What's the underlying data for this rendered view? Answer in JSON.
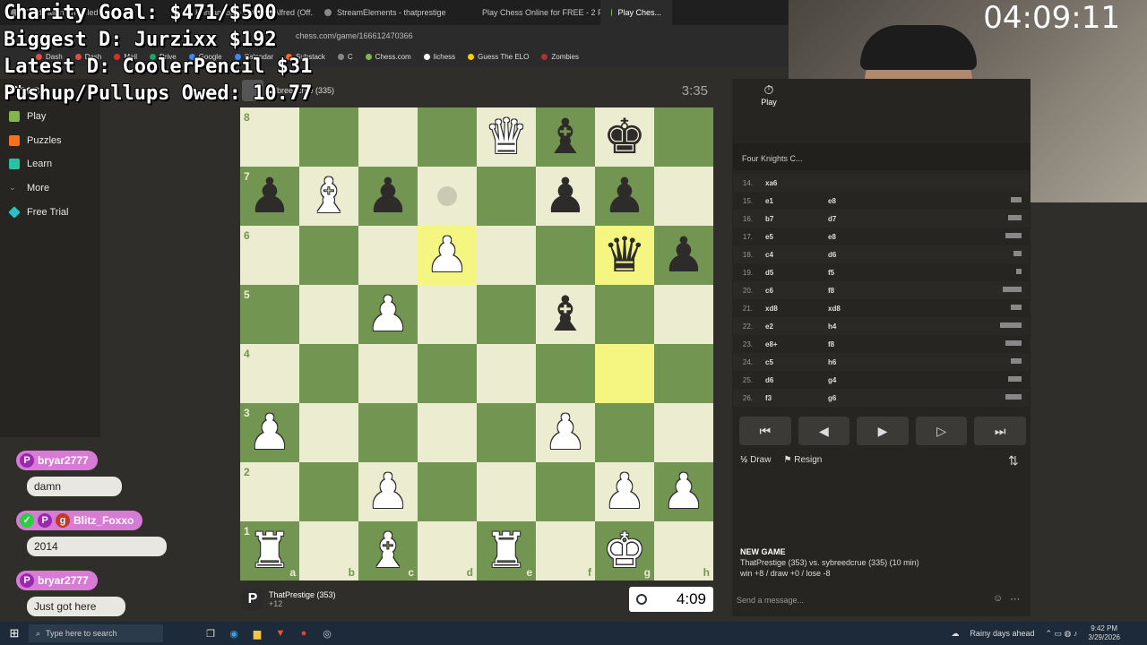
{
  "browser": {
    "tabs": [
      {
        "label": "Thirdwalkin Wheeled y...",
        "active": false
      },
      {
        "label": "Khruangbin - Dearest Alfred (Off...",
        "active": false
      },
      {
        "label": "StreamElements - thatprestige",
        "active": false
      },
      {
        "label": "Play Chess Online for FREE - 2 Playe...",
        "active": false
      },
      {
        "label": "Play Ches...",
        "active": true
      }
    ],
    "url": "chess.com/game/166612470366",
    "bookmarks": [
      {
        "label": "Dash",
        "color": "#e04b4b"
      },
      {
        "label": "Dash",
        "color": "#e04b4b"
      },
      {
        "label": "Mail",
        "color": "#d93025"
      },
      {
        "label": "Drive",
        "color": "#1fa463"
      },
      {
        "label": "Google",
        "color": "#4285f4"
      },
      {
        "label": "Calendar",
        "color": "#4285f4"
      },
      {
        "label": "Substack",
        "color": "#ff6719"
      },
      {
        "label": "C",
        "color": "#888888"
      },
      {
        "label": "Chess.com",
        "color": "#81b64c"
      },
      {
        "label": "lichess",
        "color": "#ffffff"
      },
      {
        "label": "Guess The ELO",
        "color": "#ffcc00"
      },
      {
        "label": "Zombies",
        "color": "#aa3333"
      }
    ]
  },
  "overlay": {
    "line1": "Charity Goal: $471/$500",
    "line2": "Biggest D: Jurzixx $192",
    "line3": "Latest D: CoolerPencil $31",
    "line4": "Pushup/Pullups Owed: 10.77",
    "timer": "04:09:11"
  },
  "sidebar": {
    "logo": "Chess",
    "items": [
      {
        "label": "Play",
        "color": "#81b64c"
      },
      {
        "label": "Puzzles",
        "color": "#f7711d"
      },
      {
        "label": "Learn",
        "color": "#26c2a3"
      },
      {
        "label": "More",
        "color": "#999999"
      },
      {
        "label": "Free Trial",
        "color": "#29c1c9"
      }
    ]
  },
  "top_player": {
    "name": "sybreedcrue (335)",
    "clock": "3:35"
  },
  "bottom_player": {
    "name": "ThatPrestige (353)",
    "captured": "+12",
    "clock": "4:09"
  },
  "board": {
    "files": [
      "a",
      "b",
      "c",
      "d",
      "e",
      "f",
      "g",
      "h"
    ],
    "ranks": [
      "8",
      "7",
      "6",
      "5",
      "4",
      "3",
      "2",
      "1"
    ],
    "rows": [
      [
        "",
        "",
        "",
        "",
        "wQ",
        "bB",
        "bK",
        ""
      ],
      [
        "bP",
        "wB",
        "bP",
        "dot",
        "",
        "bP",
        "bP",
        ""
      ],
      [
        "",
        "",
        "",
        "wP",
        "",
        "",
        "bQ",
        "bP"
      ],
      [
        "",
        "",
        "wP",
        "",
        "",
        "bB",
        "",
        ""
      ],
      [
        "",
        "",
        "",
        "",
        "",
        "",
        "",
        ""
      ],
      [
        "wP",
        "",
        "",
        "",
        "",
        "wP",
        "",
        ""
      ],
      [
        "",
        "",
        "wP",
        "",
        "",
        "",
        "wP",
        "wP"
      ],
      [
        "wR",
        "",
        "wB",
        "",
        "wR",
        "",
        "wK",
        ""
      ]
    ],
    "highlights": [
      "d6",
      "g6",
      "g4"
    ]
  },
  "panel": {
    "play_tab": "Play",
    "opening": "Four Knights C...",
    "moves": [
      {
        "n": "14.",
        "w": "xa6",
        "b": ""
      },
      {
        "n": "15.",
        "w": "e1",
        "b": "e8"
      },
      {
        "n": "16.",
        "w": "b7",
        "b": "d7"
      },
      {
        "n": "17.",
        "w": "e5",
        "b": "e8"
      },
      {
        "n": "18.",
        "w": "c4",
        "b": "d6"
      },
      {
        "n": "19.",
        "w": "d5",
        "b": "f5"
      },
      {
        "n": "20.",
        "w": "c6",
        "b": "f8"
      },
      {
        "n": "21.",
        "w": "xd8",
        "b": "xd8"
      },
      {
        "n": "22.",
        "w": "e2",
        "b": "h4"
      },
      {
        "n": "23.",
        "w": "e8+",
        "b": "f8"
      },
      {
        "n": "24.",
        "w": "c5",
        "b": "h6"
      },
      {
        "n": "25.",
        "w": "d6",
        "b": "g4"
      },
      {
        "n": "26.",
        "w": "f3",
        "b": "g6"
      }
    ],
    "nav": [
      "⏮",
      "◀",
      "▶",
      "▷",
      "⏭"
    ],
    "draw_label": "Draw",
    "resign_label": "Resign",
    "game_title": "NEW GAME",
    "game_line": "ThatPrestige (353) vs. sybreedcrue (335) (10 min)",
    "game_result": "win +8 / draw +0 / lose -8",
    "chat_placeholder": "Send a message..."
  },
  "chat": [
    {
      "user": "bryar2777",
      "message": "damn"
    },
    {
      "user": "Blitz_Foxxo",
      "message": "2014"
    },
    {
      "user": "bryar2777",
      "message": "Just got here"
    }
  ],
  "taskbar": {
    "search_placeholder": "Type here to search",
    "weather": "Rainy days ahead",
    "time": "9:42 PM",
    "date": "3/29/2026"
  }
}
